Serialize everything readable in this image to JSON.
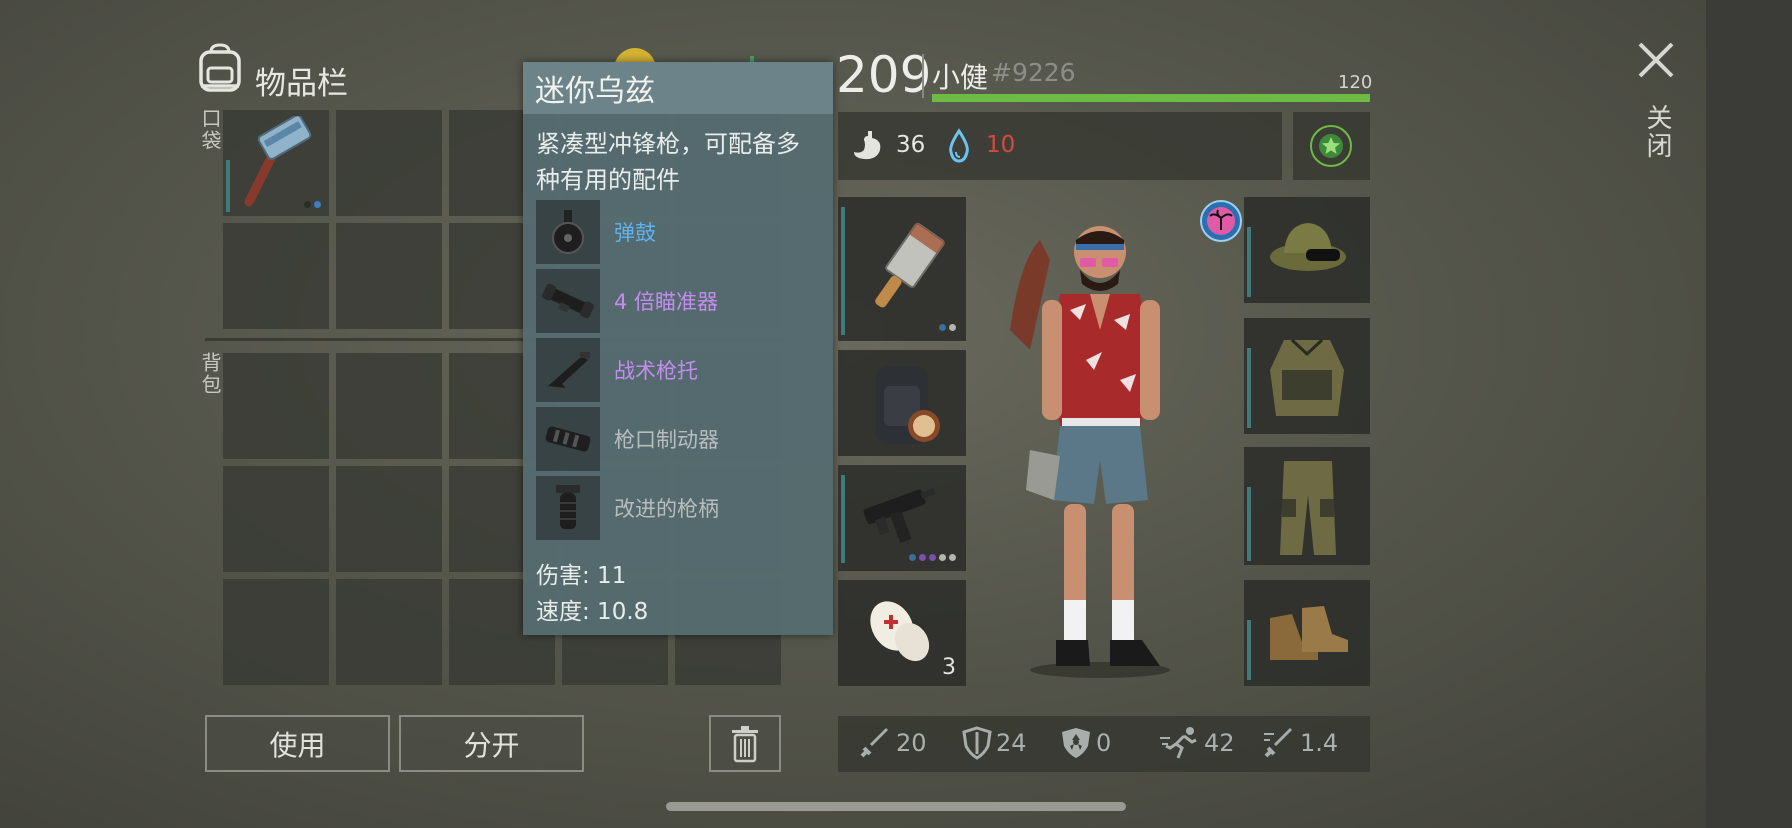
{
  "inventory": {
    "title": "物品栏",
    "pocket_label": "口袋",
    "backpack_label": "背包"
  },
  "buttons": {
    "use": "使用",
    "split": "分开"
  },
  "tooltip": {
    "title": "迷你乌兹",
    "description_line1": "紧凑型冲锋枪，可配备多",
    "description_line2": "种有用的配件",
    "attachments": [
      {
        "name": "弹鼓",
        "color": "#5fb2ee",
        "icon": "drum-magazine-icon"
      },
      {
        "name": "4 倍瞄准器",
        "color": "#c48cf0",
        "icon": "scope-icon"
      },
      {
        "name": "战术枪托",
        "color": "#c48cf0",
        "icon": "stock-icon"
      },
      {
        "name": "枪口制动器",
        "color": "#b8bdbd",
        "icon": "muzzle-brake-icon"
      },
      {
        "name": "改进的枪柄",
        "color": "#b8bdbd",
        "icon": "grip-icon"
      }
    ],
    "damage": "伤害: 11",
    "speed": "速度: 10.8"
  },
  "player": {
    "level": "209",
    "name": "小健",
    "tag": "#9226",
    "health_max": "120",
    "health_fraction": 1.0,
    "hunger": "36",
    "thirst": "10"
  },
  "equipment": {
    "medkit_count": "3"
  },
  "stats": {
    "attack": "20",
    "defense": "24",
    "armor": "0",
    "speed": "42",
    "attack_speed": "1.4"
  },
  "close_label": "关闭",
  "colors": {
    "health": "#6dbb44",
    "thirst": "#d64a3e",
    "accent_teal": "#3e7b7a",
    "star_badge": "#6dbb44"
  }
}
